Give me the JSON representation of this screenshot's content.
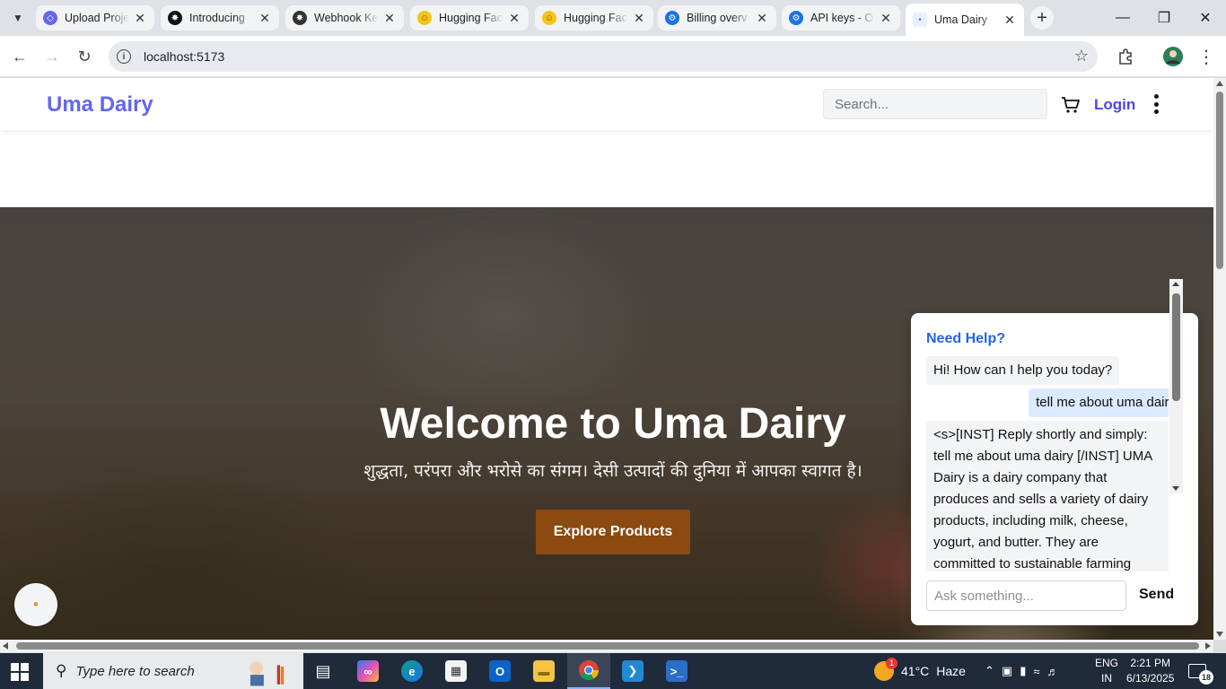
{
  "browser": {
    "tabs": [
      {
        "title": "Upload Proje",
        "icon": "stack-icon",
        "color": "#6366f1"
      },
      {
        "title": "Introducing",
        "icon": "openai-icon",
        "color": "#111111"
      },
      {
        "title": "Webhook Ke",
        "icon": "openai-icon",
        "color": "#333333"
      },
      {
        "title": "Hugging Fac",
        "icon": "hugging-face-icon",
        "color": "#f5c518"
      },
      {
        "title": "Hugging Fac",
        "icon": "hugging-face-icon",
        "color": "#f5c518"
      },
      {
        "title": "Billing overv",
        "icon": "gear-globe-icon",
        "color": "#1a73e8"
      },
      {
        "title": "API keys - O",
        "icon": "gear-globe-icon",
        "color": "#1a73e8"
      },
      {
        "title": "Uma Dairy",
        "icon": "site-favicon",
        "color": "#3b82f6"
      }
    ],
    "url": "localhost:5173"
  },
  "site": {
    "brand": "Uma Dairy",
    "search_placeholder": "Search...",
    "login": "Login",
    "accent_color": "#6366f1"
  },
  "hero": {
    "title": "Welcome to Uma Dairy",
    "subtitle": "शुद्धता, परंपरा और भरोसे का संगम। देसी उत्पादों की दुनिया में आपका स्वागत है।",
    "button": "Explore Products",
    "button_color": "#8b4a10"
  },
  "chat": {
    "title": "Need Help?",
    "messages": [
      {
        "from": "bot",
        "text": "Hi! How can I help you today?"
      },
      {
        "from": "user",
        "text": "tell me about uma dairy"
      },
      {
        "from": "bot",
        "text": "<s>[INST] Reply shortly and simply: tell me about uma dairy [/INST] UMA Dairy is a dairy company that produces and sells a variety of dairy products, including milk, cheese, yogurt, and butter. They are committed to sustainable farming"
      }
    ],
    "input_placeholder": "Ask something...",
    "send": "Send"
  },
  "taskbar": {
    "search_placeholder": "Type here to search",
    "weather": {
      "temp": "41°C",
      "condition": "Haze",
      "badge": "1"
    },
    "language": {
      "line1": "ENG",
      "line2": "IN"
    },
    "time": "2:21 PM",
    "date": "6/13/2025",
    "notifications": "18"
  }
}
